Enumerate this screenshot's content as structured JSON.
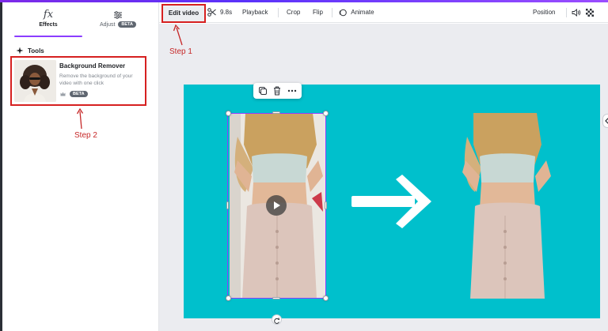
{
  "sidebar": {
    "tabs": [
      {
        "label": "Effects",
        "icon": "fx-icon"
      },
      {
        "label": "Adjust",
        "badge": "BETA",
        "icon": "sliders-icon"
      }
    ],
    "tools_heading": "Tools",
    "card": {
      "title": "Background Remover",
      "description": "Remove the background of your video with one click",
      "badge": "BETA"
    }
  },
  "annotations": {
    "step1": "Step 1",
    "step2": "Step 2"
  },
  "toolbar": {
    "edit_video": "Edit video",
    "duration": "9.8s",
    "playback": "Playback",
    "crop": "Crop",
    "flip": "Flip",
    "animate": "Animate",
    "position": "Position"
  },
  "colors": {
    "accent": "#8b3dff",
    "canvas_bg": "#00c0cc",
    "annotation": "#d62020"
  }
}
